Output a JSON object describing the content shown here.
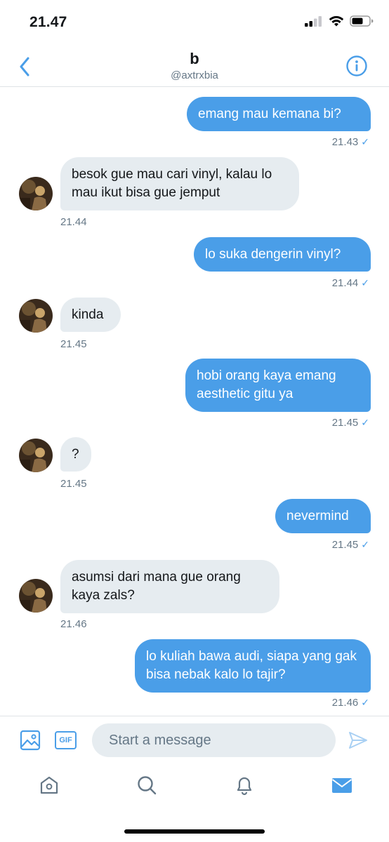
{
  "status_bar": {
    "time": "21.47"
  },
  "header": {
    "title": "b",
    "handle": "@axtrxbia"
  },
  "messages": [
    {
      "text": "emang mau kemana bi?",
      "time": "21.43"
    },
    {
      "text": "besok gue mau cari vinyl, kalau lo mau ikut bisa gue jemput",
      "time": "21.44"
    },
    {
      "text": "lo suka dengerin vinyl?",
      "time": "21.44"
    },
    {
      "text": "kinda",
      "time": "21.45"
    },
    {
      "text": "hobi orang kaya emang aesthetic gitu ya",
      "time": "21.45"
    },
    {
      "text": "?",
      "time": "21.45"
    },
    {
      "text": "nevermind",
      "time": "21.45"
    },
    {
      "text": "asumsi dari mana gue orang kaya zals?",
      "time": "21.46"
    },
    {
      "text": "lo kuliah bawa audi, siapa yang gak bisa nebak kalo lo tajir?",
      "time": "21.46"
    }
  ],
  "composer": {
    "gif_label": "GIF",
    "placeholder": "Start a message"
  },
  "colors": {
    "accent": "#4a9ee8",
    "incoming_bubble": "#e6ecf0",
    "muted_text": "#657786"
  }
}
